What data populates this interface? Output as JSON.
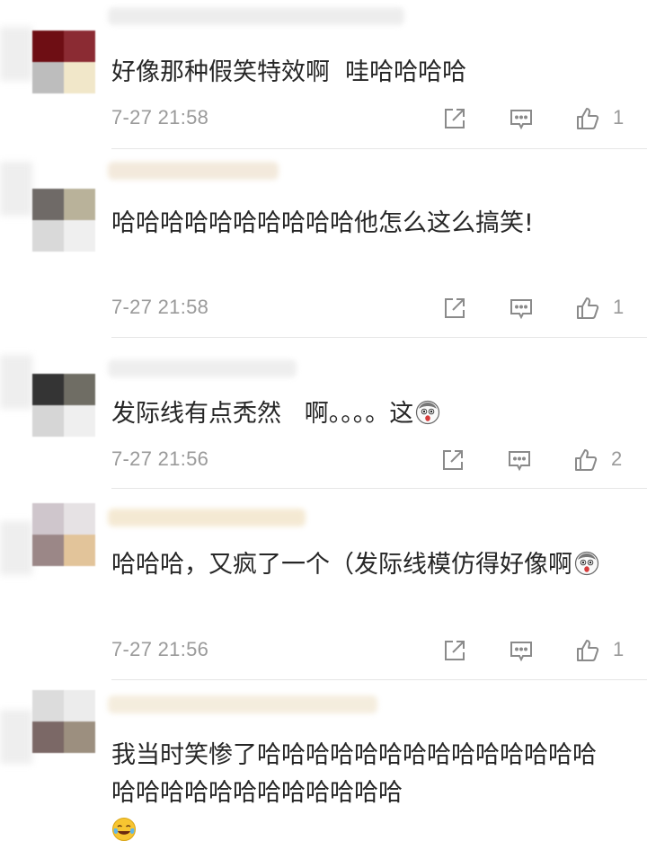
{
  "comments": [
    {
      "text": "好像那种假笑特效啊  哇哈哈哈哈",
      "time": "7-27 21:58",
      "likes": "1",
      "emoji": ""
    },
    {
      "text": "哈哈哈哈哈哈哈哈哈哈他怎么这么搞笑!",
      "time": "7-27 21:58",
      "likes": "1",
      "emoji": ""
    },
    {
      "text": "发际线有点秃然   啊。。。。这",
      "time": "7-27 21:56",
      "likes": "2",
      "emoji": "shocked-face-emoji"
    },
    {
      "text": "哈哈哈，又疯了一个（发际线模仿得好像啊",
      "time": "7-27 21:56",
      "likes": "1",
      "emoji": "shocked-face-emoji"
    },
    {
      "text": "我当时笑惨了哈哈哈哈哈哈哈哈哈哈哈哈哈哈哈哈哈哈哈哈哈哈哈哈哈哈",
      "time": "",
      "likes": "",
      "emoji": "laughing-crying-emoji"
    }
  ],
  "icons": {
    "share": "share-icon",
    "reply": "comment-icon",
    "like": "thumbs-up-icon"
  },
  "colors": {
    "text": "#262626",
    "meta": "#9a9a9a",
    "divider": "#e6e6e6"
  }
}
